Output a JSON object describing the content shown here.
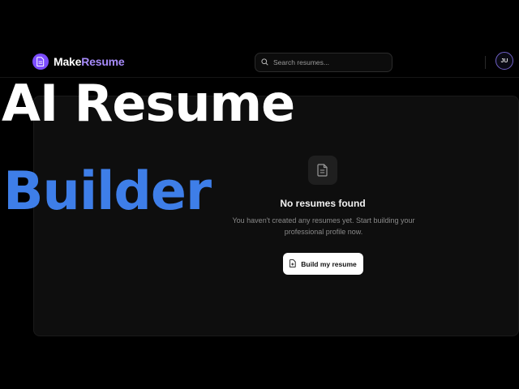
{
  "header": {
    "brand_prefix": "Make",
    "brand_suffix": "Resume",
    "search_placeholder": "Search resumes...",
    "avatar_initials": "JU"
  },
  "overlay": {
    "line1": "AI Resume",
    "line2": "Builder"
  },
  "empty_state": {
    "title": "No resumes found",
    "description": "You haven't created any resumes yet. Start building your professional profile now.",
    "button_label": "Build my resume"
  },
  "colors": {
    "background": "#000000",
    "brand_accent": "#7c4dff",
    "overlay_blue": "#3e7ee8"
  },
  "icons": {
    "brand": "document-icon",
    "search": "search-icon",
    "empty": "document-icon",
    "button": "document-add-icon"
  }
}
